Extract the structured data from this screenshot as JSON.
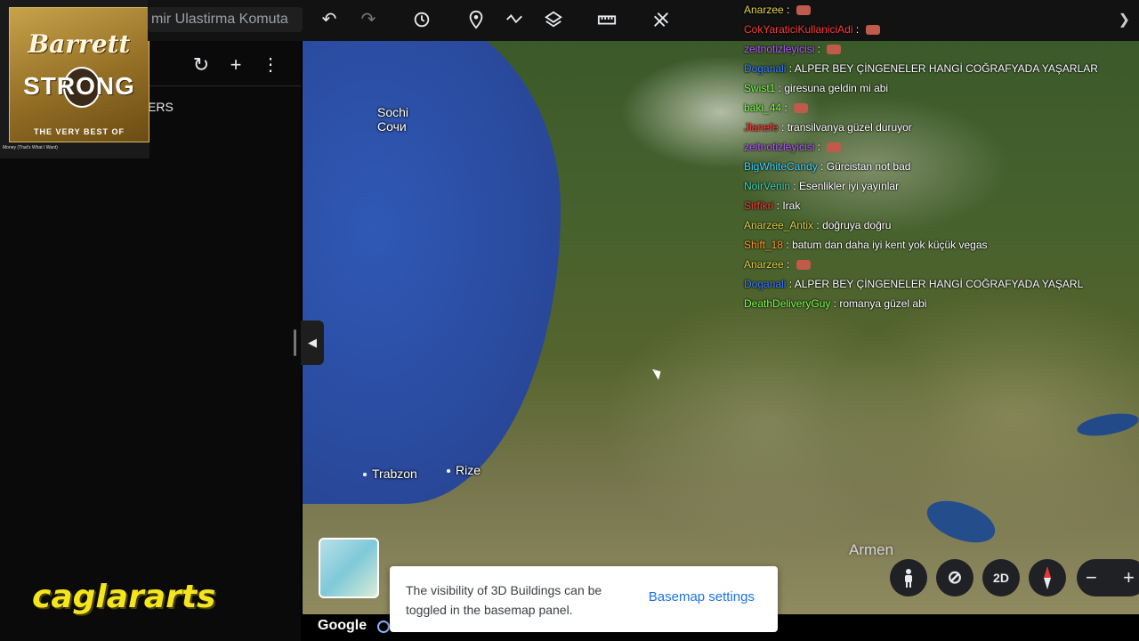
{
  "app": {
    "title_fragment": "mir Ulastirma Komuta"
  },
  "sidebar": {
    "label_fragment": "ERS",
    "refresh_icon": "refresh-icon",
    "add_icon": "add-icon",
    "more_icon": "more-vert-icon",
    "collapse_icon": "chevron-left-icon"
  },
  "album": {
    "artist_line1": "Barrett",
    "artist_line2": "STRONG",
    "subtitle": "THE VERY BEST OF",
    "caption": "Money (That's What I Want)"
  },
  "watermark": "caglararts",
  "toolbar": {
    "tools": [
      "undo-icon",
      "redo-icon",
      "history-icon",
      "place-pin-icon",
      "path-icon",
      "layers-icon",
      "ruler-icon",
      "satellite-icon"
    ]
  },
  "map": {
    "places": [
      {
        "name": "Sochi",
        "alt": "Сочи"
      },
      {
        "name": "Trabzon"
      },
      {
        "name": "Rize"
      }
    ],
    "region_label": "Armen"
  },
  "chat": [
    {
      "user": "Anarzee",
      "color": "#e0d04a",
      "message": "",
      "emote": true
    },
    {
      "user": "CokYaraticiKullaniciAdi",
      "color": "#ff3b3b",
      "message": "",
      "emote": true
    },
    {
      "user": "zeitnotizleyicisi",
      "color": "#b65cff",
      "message": "",
      "emote": true
    },
    {
      "user": "Doganali",
      "color": "#3a7bff",
      "message": "ALPER BEY ÇİNGENELER HANGİ COĞRAFYADA YAŞARLAR",
      "emote": false
    },
    {
      "user": "Swist1",
      "color": "#7cff4a",
      "message": "giresuna geldin mi abi",
      "emote": false
    },
    {
      "user": "baki_44",
      "color": "#7cff4a",
      "message": "",
      "emote": true
    },
    {
      "user": "Jlanefe",
      "color": "#ff3b3b",
      "message": "transilvanya güzel duruyor",
      "emote": false
    },
    {
      "user": "zeitnotizleyicisi",
      "color": "#b65cff",
      "message": "",
      "emote": true
    },
    {
      "user": "BigWhiteCandy",
      "color": "#3ed6ff",
      "message": "Gürcistan not bad",
      "emote": false
    },
    {
      "user": "NoirVenin",
      "color": "#3ed6b0",
      "message": "Esenlikler iyi yayınlar",
      "emote": false
    },
    {
      "user": "Sirfikri",
      "color": "#ff3b3b",
      "message": "Irak",
      "emote": false
    },
    {
      "user": "Anarzee_Antix",
      "color": "#e0d04a",
      "message": "doğruya doğru",
      "emote": false
    },
    {
      "user": "Shift_18",
      "color": "#ff9a2a",
      "message": "batum dan daha iyi kent yok küçük vegas",
      "emote": false
    },
    {
      "user": "Anarzee",
      "color": "#e0d04a",
      "message": "",
      "emote": true
    },
    {
      "user": "Doganali",
      "color": "#3a7bff",
      "message": "ALPER BEY ÇİNGENELER HANGİ COĞRAFYADA YAŞARL",
      "emote": false
    },
    {
      "user": "DeathDeliveryGuy",
      "color": "#7cff4a",
      "message": "romanya güzel abi",
      "emote": false
    }
  ],
  "bottom": {
    "google_label": "Google",
    "toast_text": "The visibility of 3D Buildings can be toggled in the basemap panel.",
    "toast_link": "Basemap settings",
    "view_mode": "2D",
    "zoom_out": "−",
    "zoom_in": "+"
  }
}
